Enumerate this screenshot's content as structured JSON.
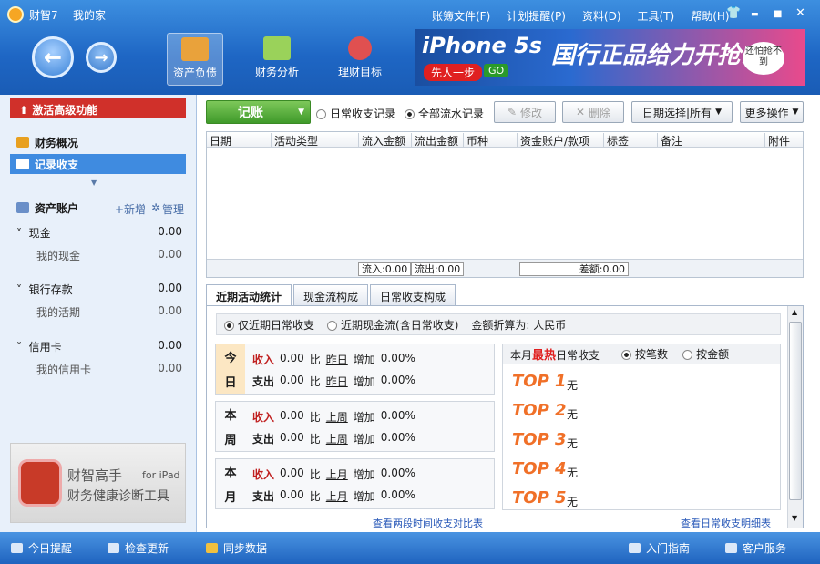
{
  "window": {
    "app_name": "财智7",
    "separator": "-",
    "doc_name": "我的家"
  },
  "menu": [
    "账簿文件(F)",
    "计划提醒(P)",
    "资料(D)",
    "工具(T)",
    "帮助(H)"
  ],
  "window_controls": {
    "skin": "👕",
    "minimize": "▬",
    "maximize": "■",
    "close": "✕"
  },
  "nav": {
    "back": "←",
    "forward": "→"
  },
  "toolbar": [
    {
      "label": "资产负债",
      "active": true,
      "color": "#e9a23b"
    },
    {
      "label": "财务分析",
      "active": false,
      "color": "#9ad25a"
    },
    {
      "label": "理财目标",
      "active": false,
      "color": "#e05050"
    }
  ],
  "banner": {
    "headline": "iPhone 5s",
    "slogan": "国行正品给力开抢!",
    "tag": "先人一步",
    "go": "GO",
    "bubble": "还怕抢不到"
  },
  "sidebar": {
    "promo": "激活高级功能",
    "nav": [
      {
        "label": "财务概况",
        "selected": false
      },
      {
        "label": "记录收支",
        "selected": true
      }
    ],
    "accounts_title": "资产账户",
    "add_label": "+新增",
    "manage_label": "管理",
    "groups": [
      {
        "name": "现金",
        "amount": "0.00",
        "sub": "我的现金",
        "sub_amount": "0.00"
      },
      {
        "name": "银行存款",
        "amount": "0.00",
        "sub": "我的活期",
        "sub_amount": "0.00"
      },
      {
        "name": "信用卡",
        "amount": "0.00",
        "sub": "我的信用卡",
        "sub_amount": "0.00"
      }
    ],
    "ad": {
      "title": "财智高手",
      "subtitle": "for iPad",
      "desc": "财务健康诊断工具"
    }
  },
  "actions": {
    "record": "记账",
    "radio_daily": "日常收支记录",
    "radio_all": "全部流水记录",
    "edit": "修改",
    "delete": "删除",
    "date_select": "日期选择|所有",
    "more": "更多操作"
  },
  "table": {
    "columns": [
      "日期",
      "活动类型",
      "流入金额",
      "流出金额",
      "币种",
      "资金账户/款项",
      "标签",
      "备注",
      "附件"
    ],
    "inflow": "流入:0.00",
    "outflow": "流出:0.00",
    "diff": "差额:0.00"
  },
  "tabs": [
    "近期活动统计",
    "现金流构成",
    "日常收支构成"
  ],
  "stats": {
    "opt_daily": "仅近期日常收支",
    "opt_cash": "近期现金流(含日常收支)",
    "currency": "金额折算为: 人民币",
    "periods": [
      {
        "label": [
          "今",
          "日"
        ],
        "compare": "昨日"
      },
      {
        "label": [
          "本",
          "周"
        ],
        "compare": "上周"
      },
      {
        "label": [
          "本",
          "月"
        ],
        "compare": "上月"
      }
    ],
    "income": "收入",
    "expense": "支出",
    "value": "0.00",
    "vs": "比",
    "increase": "增加",
    "pct": "0.00%",
    "top": {
      "prefix": "本月",
      "hot": "最热",
      "suffix": "日常收支",
      "by_count": "按笔数",
      "by_amount": "按金额",
      "items": [
        {
          "rank": "TOP 1",
          "value": "无"
        },
        {
          "rank": "TOP 2",
          "value": "无"
        },
        {
          "rank": "TOP 3",
          "value": "无"
        },
        {
          "rank": "TOP 4",
          "value": "无"
        },
        {
          "rank": "TOP 5",
          "value": "无"
        }
      ]
    },
    "link_left": "查看两段时间收支对比表",
    "link_right": "查看日常收支明细表"
  },
  "statusbar": {
    "reminder": "今日提醒",
    "update": "检查更新",
    "sync": "同步数据",
    "guide": "入门指南",
    "service": "客户服务"
  }
}
